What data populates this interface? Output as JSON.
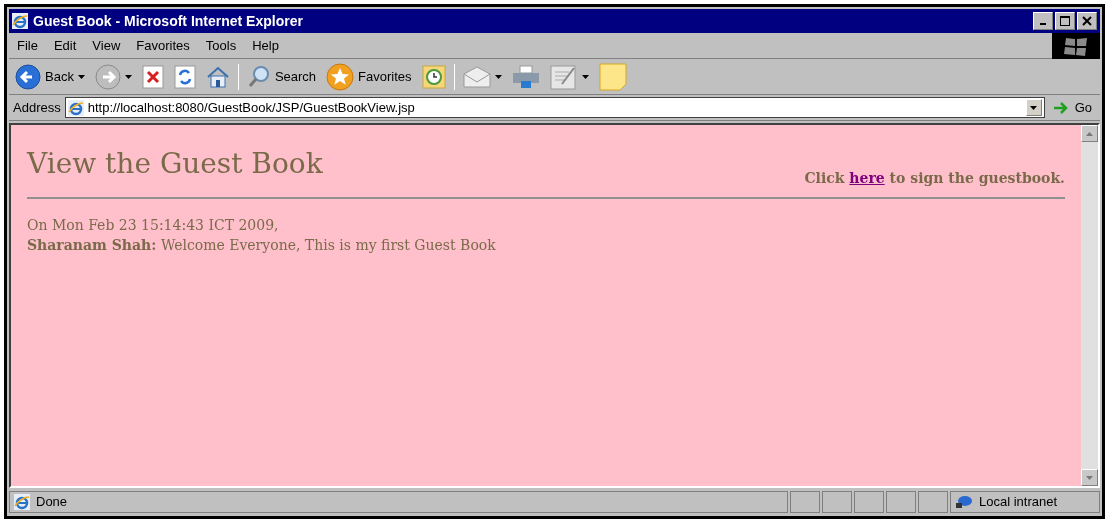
{
  "window": {
    "title": "Guest Book - Microsoft Internet Explorer"
  },
  "menu": [
    "File",
    "Edit",
    "View",
    "Favorites",
    "Tools",
    "Help"
  ],
  "toolbar": [
    {
      "kind": "back",
      "label": "Back"
    },
    {
      "kind": "forward"
    },
    {
      "kind": "stop"
    },
    {
      "kind": "refresh"
    },
    {
      "kind": "home"
    },
    {
      "kind": "sep"
    },
    {
      "kind": "search",
      "label": "Search"
    },
    {
      "kind": "favorites",
      "label": "Favorites"
    },
    {
      "kind": "history"
    },
    {
      "kind": "sep"
    },
    {
      "kind": "mail"
    },
    {
      "kind": "print"
    },
    {
      "kind": "edit"
    },
    {
      "kind": "note"
    }
  ],
  "address": {
    "label": "Address",
    "value": "http://localhost:8080/GuestBook/JSP/GuestBookView.jsp",
    "go": "Go"
  },
  "page": {
    "heading": "View the Guest Book",
    "sign_prompt": {
      "before": "Click",
      "link": "here",
      "after": "to sign the guestbook."
    },
    "entries": [
      {
        "date": "On Mon Feb 23 15:14:43 ICT 2009,",
        "author": "Sharanam Shah:",
        "message": "Welcome Everyone, This is my first Guest Book"
      }
    ]
  },
  "status_bar": {
    "text": "Done",
    "zone": "Local intranet"
  }
}
